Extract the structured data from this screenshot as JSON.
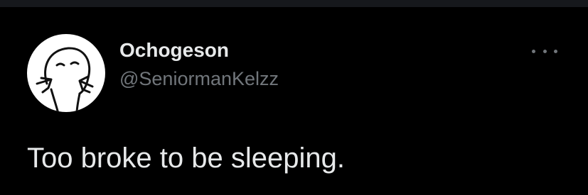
{
  "tweet": {
    "author": {
      "display_name": "Ochogeson",
      "handle": "@SeniormanKelzz",
      "avatar_icon": "cartoon-face-pointing-icon"
    },
    "text": "Too broke to be sleeping.",
    "more_icon": "more-options-icon"
  },
  "colors": {
    "background": "#000000",
    "primary_text": "#e7e9ea",
    "secondary_text": "#71767b",
    "avatar_background": "#ffffff"
  }
}
